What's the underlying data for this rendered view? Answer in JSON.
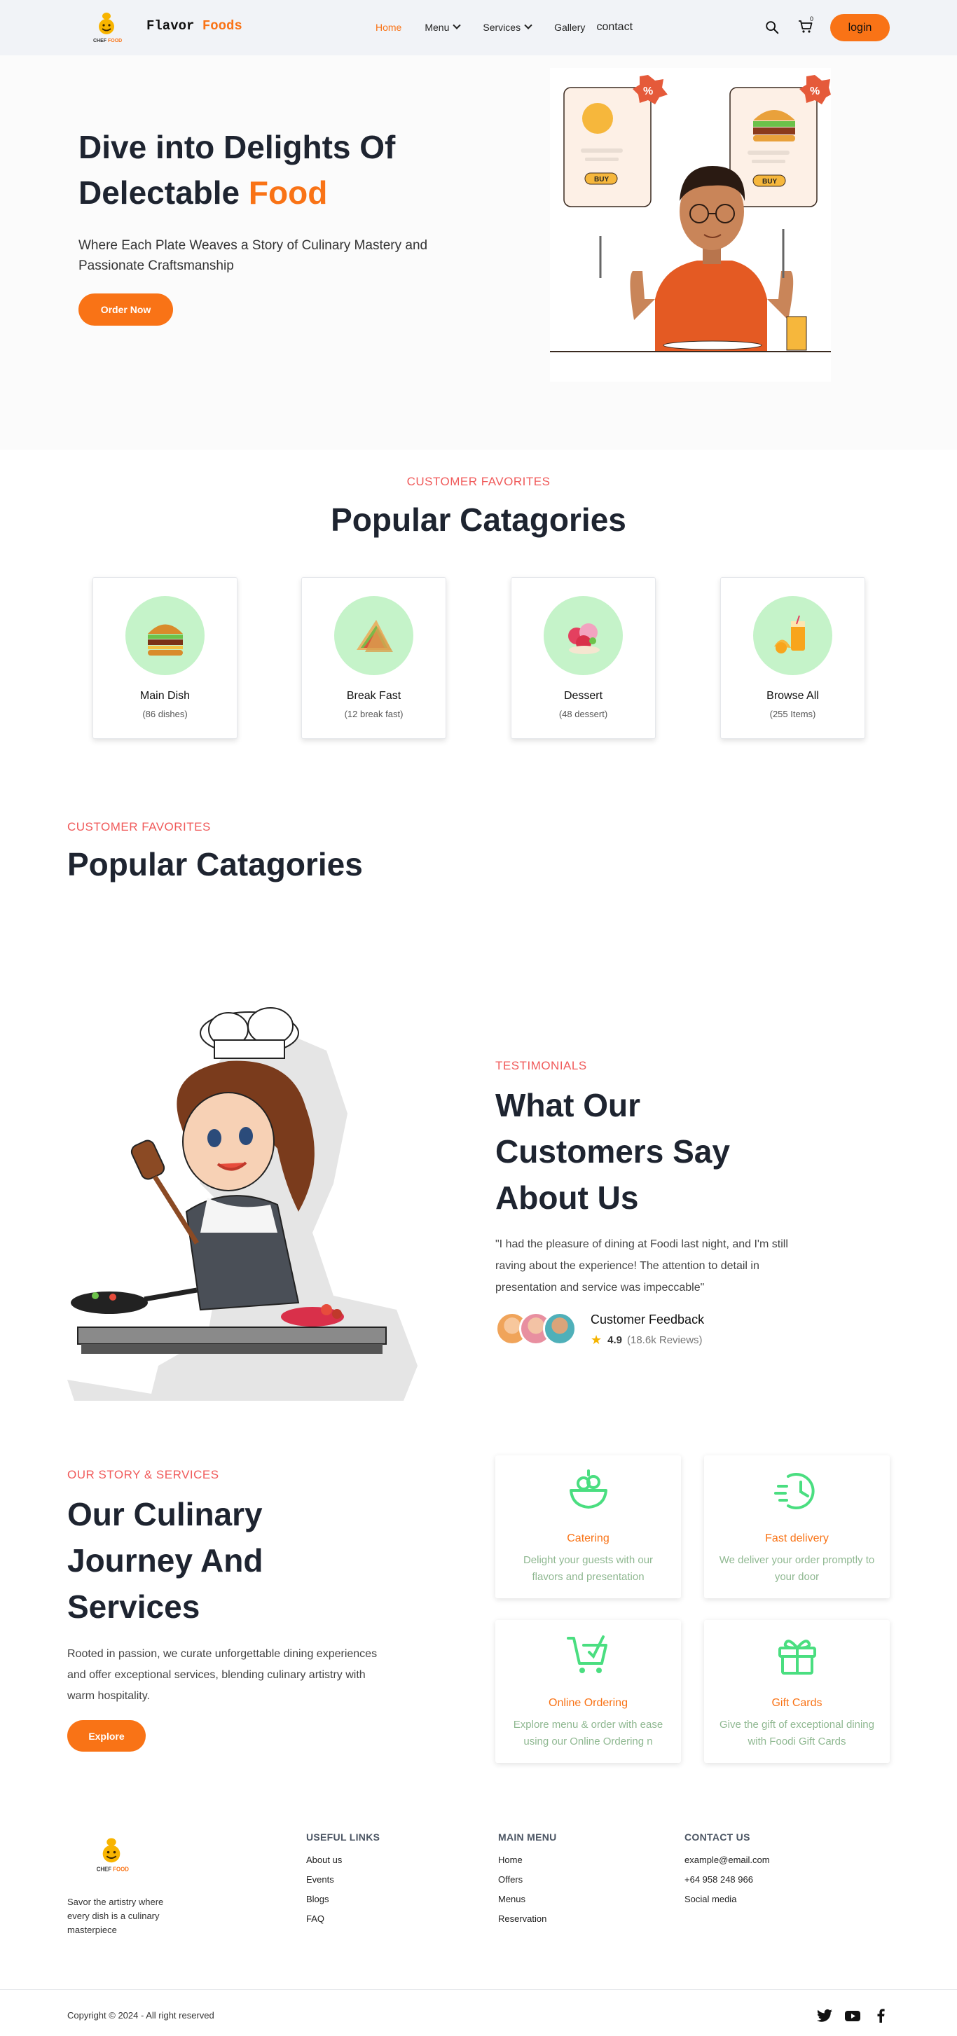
{
  "nav": {
    "brand_part1": "Flavor",
    "brand_part2": "Foods",
    "logo_text_chef": "CHEF",
    "logo_text_food": "FOOD",
    "links": [
      {
        "label": "Home"
      },
      {
        "label": "Menu"
      },
      {
        "label": "Services"
      },
      {
        "label": "Gallery"
      },
      {
        "label": "contact"
      }
    ],
    "cart_count": "0",
    "login_label": "login"
  },
  "hero": {
    "title_line1": "Dive into Delights Of",
    "title_line2_prefix": "Delectable",
    "title_line2_accent": "Food",
    "subtitle": "Where Each Plate Weaves a Story of Culinary Mastery and Passionate Craftsmanship",
    "cta_label": "Order Now",
    "illus_buy_label": "BUY"
  },
  "categories": {
    "eyebrow": "CUSTOMER FAVORITES",
    "title": "Popular Catagories",
    "items": [
      {
        "name": "Main Dish",
        "count": "(86 dishes)",
        "icon": "burger-icon"
      },
      {
        "name": "Break Fast",
        "count": "(12 break fast)",
        "icon": "sandwich-icon"
      },
      {
        "name": "Dessert",
        "count": "(48 dessert)",
        "icon": "dessert-icon"
      },
      {
        "name": "Browse All",
        "count": "(255 Items)",
        "icon": "juice-icon"
      }
    ]
  },
  "categories_secondary": {
    "eyebrow": "CUSTOMER FAVORITES",
    "title": "Popular Catagories"
  },
  "testimonials": {
    "eyebrow": "TESTIMONIALS",
    "title": "What Our Customers Say About Us",
    "quote": "\"I had the pleasure of dining at Foodi last night, and I'm still raving about the experience! The attention to detail in presentation and service was impeccable\"",
    "feedback_title": "Customer Feedback",
    "rating": "4.9",
    "reviews": "(18.6k Reviews)"
  },
  "services": {
    "eyebrow": "OUR STORY & SERVICES",
    "title": "Our Culinary Journey And Services",
    "description": "Rooted in passion, we curate unforgettable dining experiences and offer exceptional services, blending culinary artistry with warm hospitality.",
    "cta_label": "Explore",
    "items": [
      {
        "name": "Catering",
        "desc": "Delight your guests with our flavors and presentation",
        "icon": "salad-bowl-icon"
      },
      {
        "name": "Fast delivery",
        "desc": "We deliver your order promptly to your door",
        "icon": "fast-clock-icon"
      },
      {
        "name": "Online Ordering",
        "desc": "Explore menu & order with ease using our Online Ordering n",
        "icon": "cart-check-icon"
      },
      {
        "name": "Gift Cards",
        "desc": "Give the gift of exceptional dining with Foodi Gift Cards",
        "icon": "gift-icon"
      }
    ],
    "accent_green": "#4ade80",
    "accent_orange": "#f97316"
  },
  "footer": {
    "tagline": "Savor the artistry where every dish is a culinary masterpiece",
    "columns": [
      {
        "heading": "USEFUL LINKS",
        "links": [
          "About us",
          "Events",
          "Blogs",
          "FAQ"
        ]
      },
      {
        "heading": "MAIN MENU",
        "links": [
          "Home",
          "Offers",
          "Menus",
          "Reservation"
        ]
      },
      {
        "heading": "CONTACT US",
        "links": [
          "example@email.com",
          "+64 958 248 966",
          "Social media"
        ]
      }
    ],
    "copyright": "Copyright © 2024 - All right reserved",
    "social": [
      "twitter-icon",
      "youtube-icon",
      "facebook-icon"
    ]
  }
}
